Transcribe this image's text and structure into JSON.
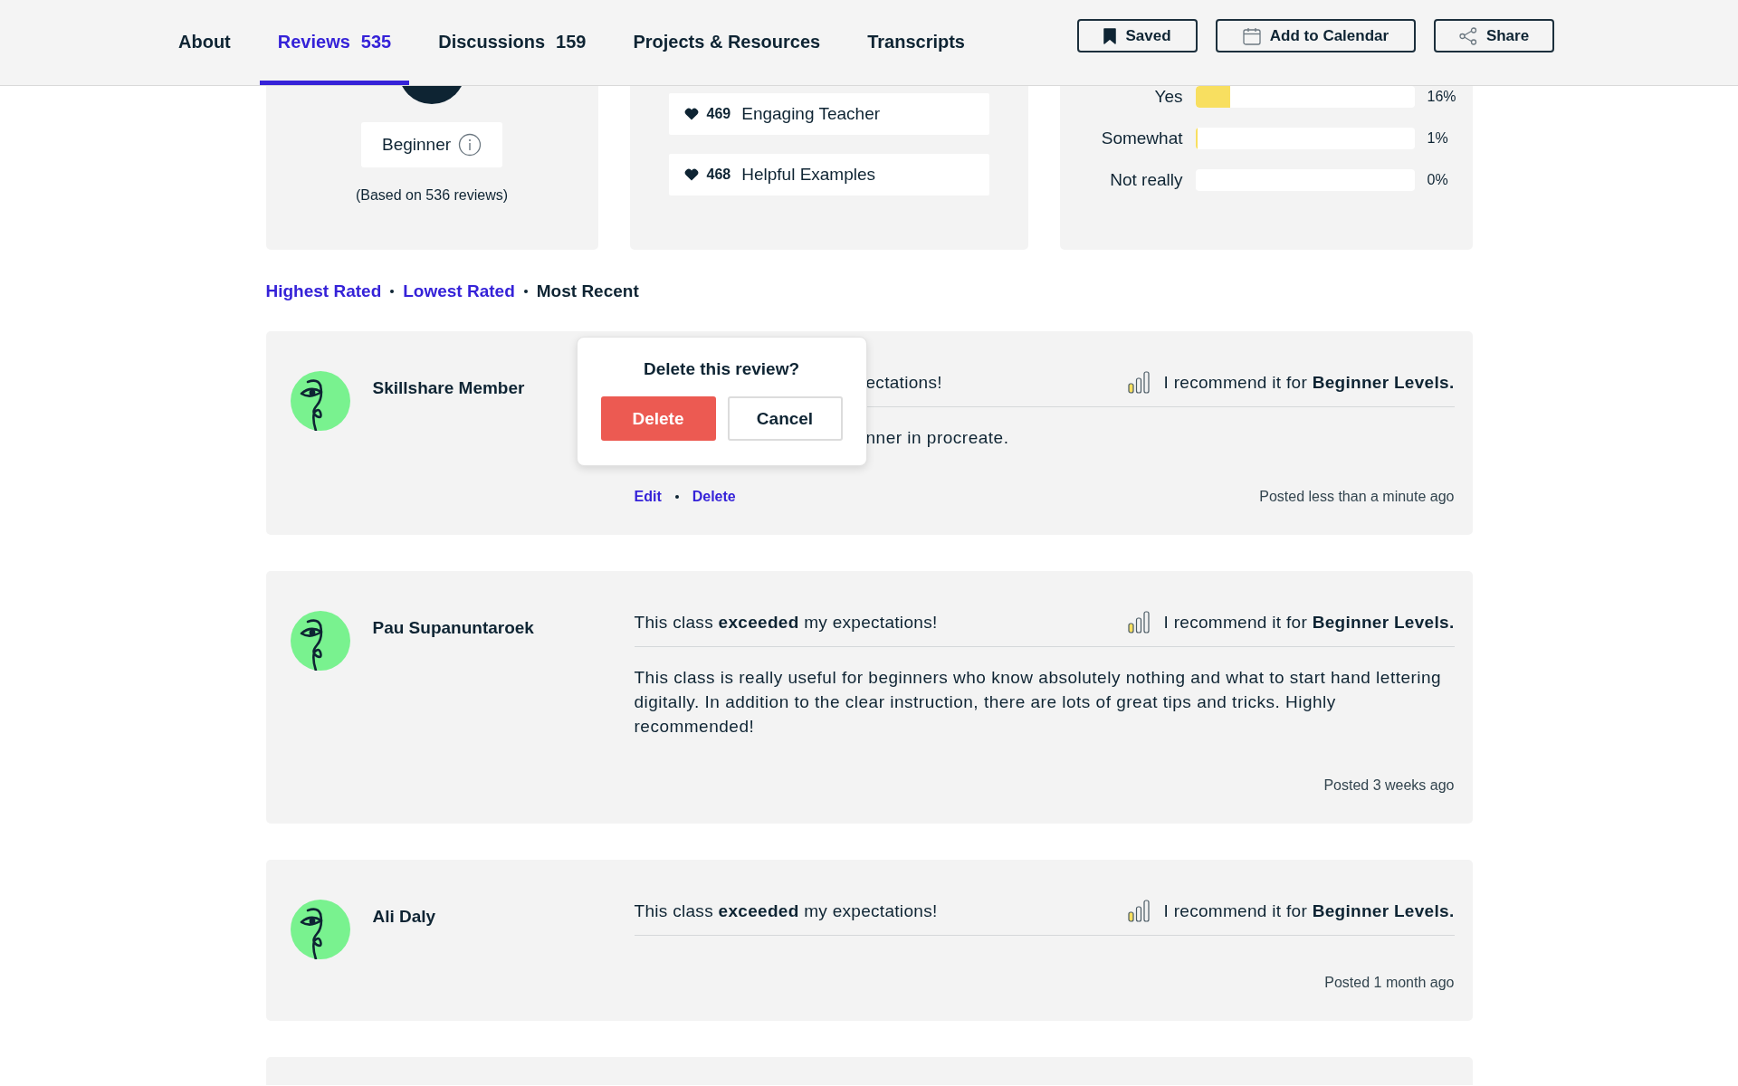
{
  "nav": {
    "tabs": [
      {
        "label": "About",
        "selected": false
      },
      {
        "label": "Reviews",
        "count": "535",
        "selected": true
      },
      {
        "label": "Discussions",
        "count": "159",
        "selected": false
      },
      {
        "label": "Projects & Resources",
        "selected": false
      },
      {
        "label": "Transcripts",
        "selected": false
      }
    ],
    "buttons": [
      "Saved",
      "Add to Calendar",
      "Share"
    ]
  },
  "summary": {
    "level_card": {
      "level": "Beginner",
      "note": "(Based on 536 reviews)"
    },
    "tags_card": {
      "tags": [
        {
          "count": "469",
          "label": "Engaging Teacher"
        },
        {
          "count": "468",
          "label": "Helpful Examples"
        }
      ]
    },
    "expectations_card": {
      "rows": [
        {
          "label": "Yes",
          "level": 0.16,
          "reading": "16%"
        },
        {
          "label": "Somewhat",
          "level": 0.01,
          "reading": "1%"
        },
        {
          "label": "Not really",
          "reading": "0%"
        }
      ]
    }
  },
  "sort": {
    "options": [
      {
        "label": "Highest Rated",
        "selected": false
      },
      {
        "label": "Lowest Rated",
        "selected": false
      },
      {
        "label": "Most Recent",
        "selected": true
      }
    ]
  },
  "reviews": [
    {
      "name": "Skillshare Member",
      "headline": "ectations!",
      "recommendation": "I recommend it for **Beginner Levels.**",
      "body": "nner in procreate.",
      "actions": [
        "Edit",
        "Delete"
      ],
      "posted": "Posted less than a minute ago",
      "confirm_delete": {
        "title": "Delete this review?",
        "buttons": [
          {
            "label": "Delete",
            "kind": "danger"
          },
          {
            "label": "Cancel",
            "kind": "secondary"
          }
        ]
      }
    },
    {
      "name": "Pau Supanuntaroek",
      "headline": "This class **exceeded** my expectations!",
      "recommendation": "I recommend it for **Beginner Levels.**",
      "body": "This class is really useful for beginners who know absolutely nothing and what to start hand lettering digitally. In addition to the clear instruction, there are lots of great tips and tricks. Highly recommended!",
      "posted": "Posted 3 weeks ago"
    },
    {
      "name": "Ali Daly",
      "headline": "This class **exceeded** my expectations!",
      "recommendation": "I recommend it for **Beginner Levels.**",
      "posted": "Posted 1 month ago"
    }
  ]
}
